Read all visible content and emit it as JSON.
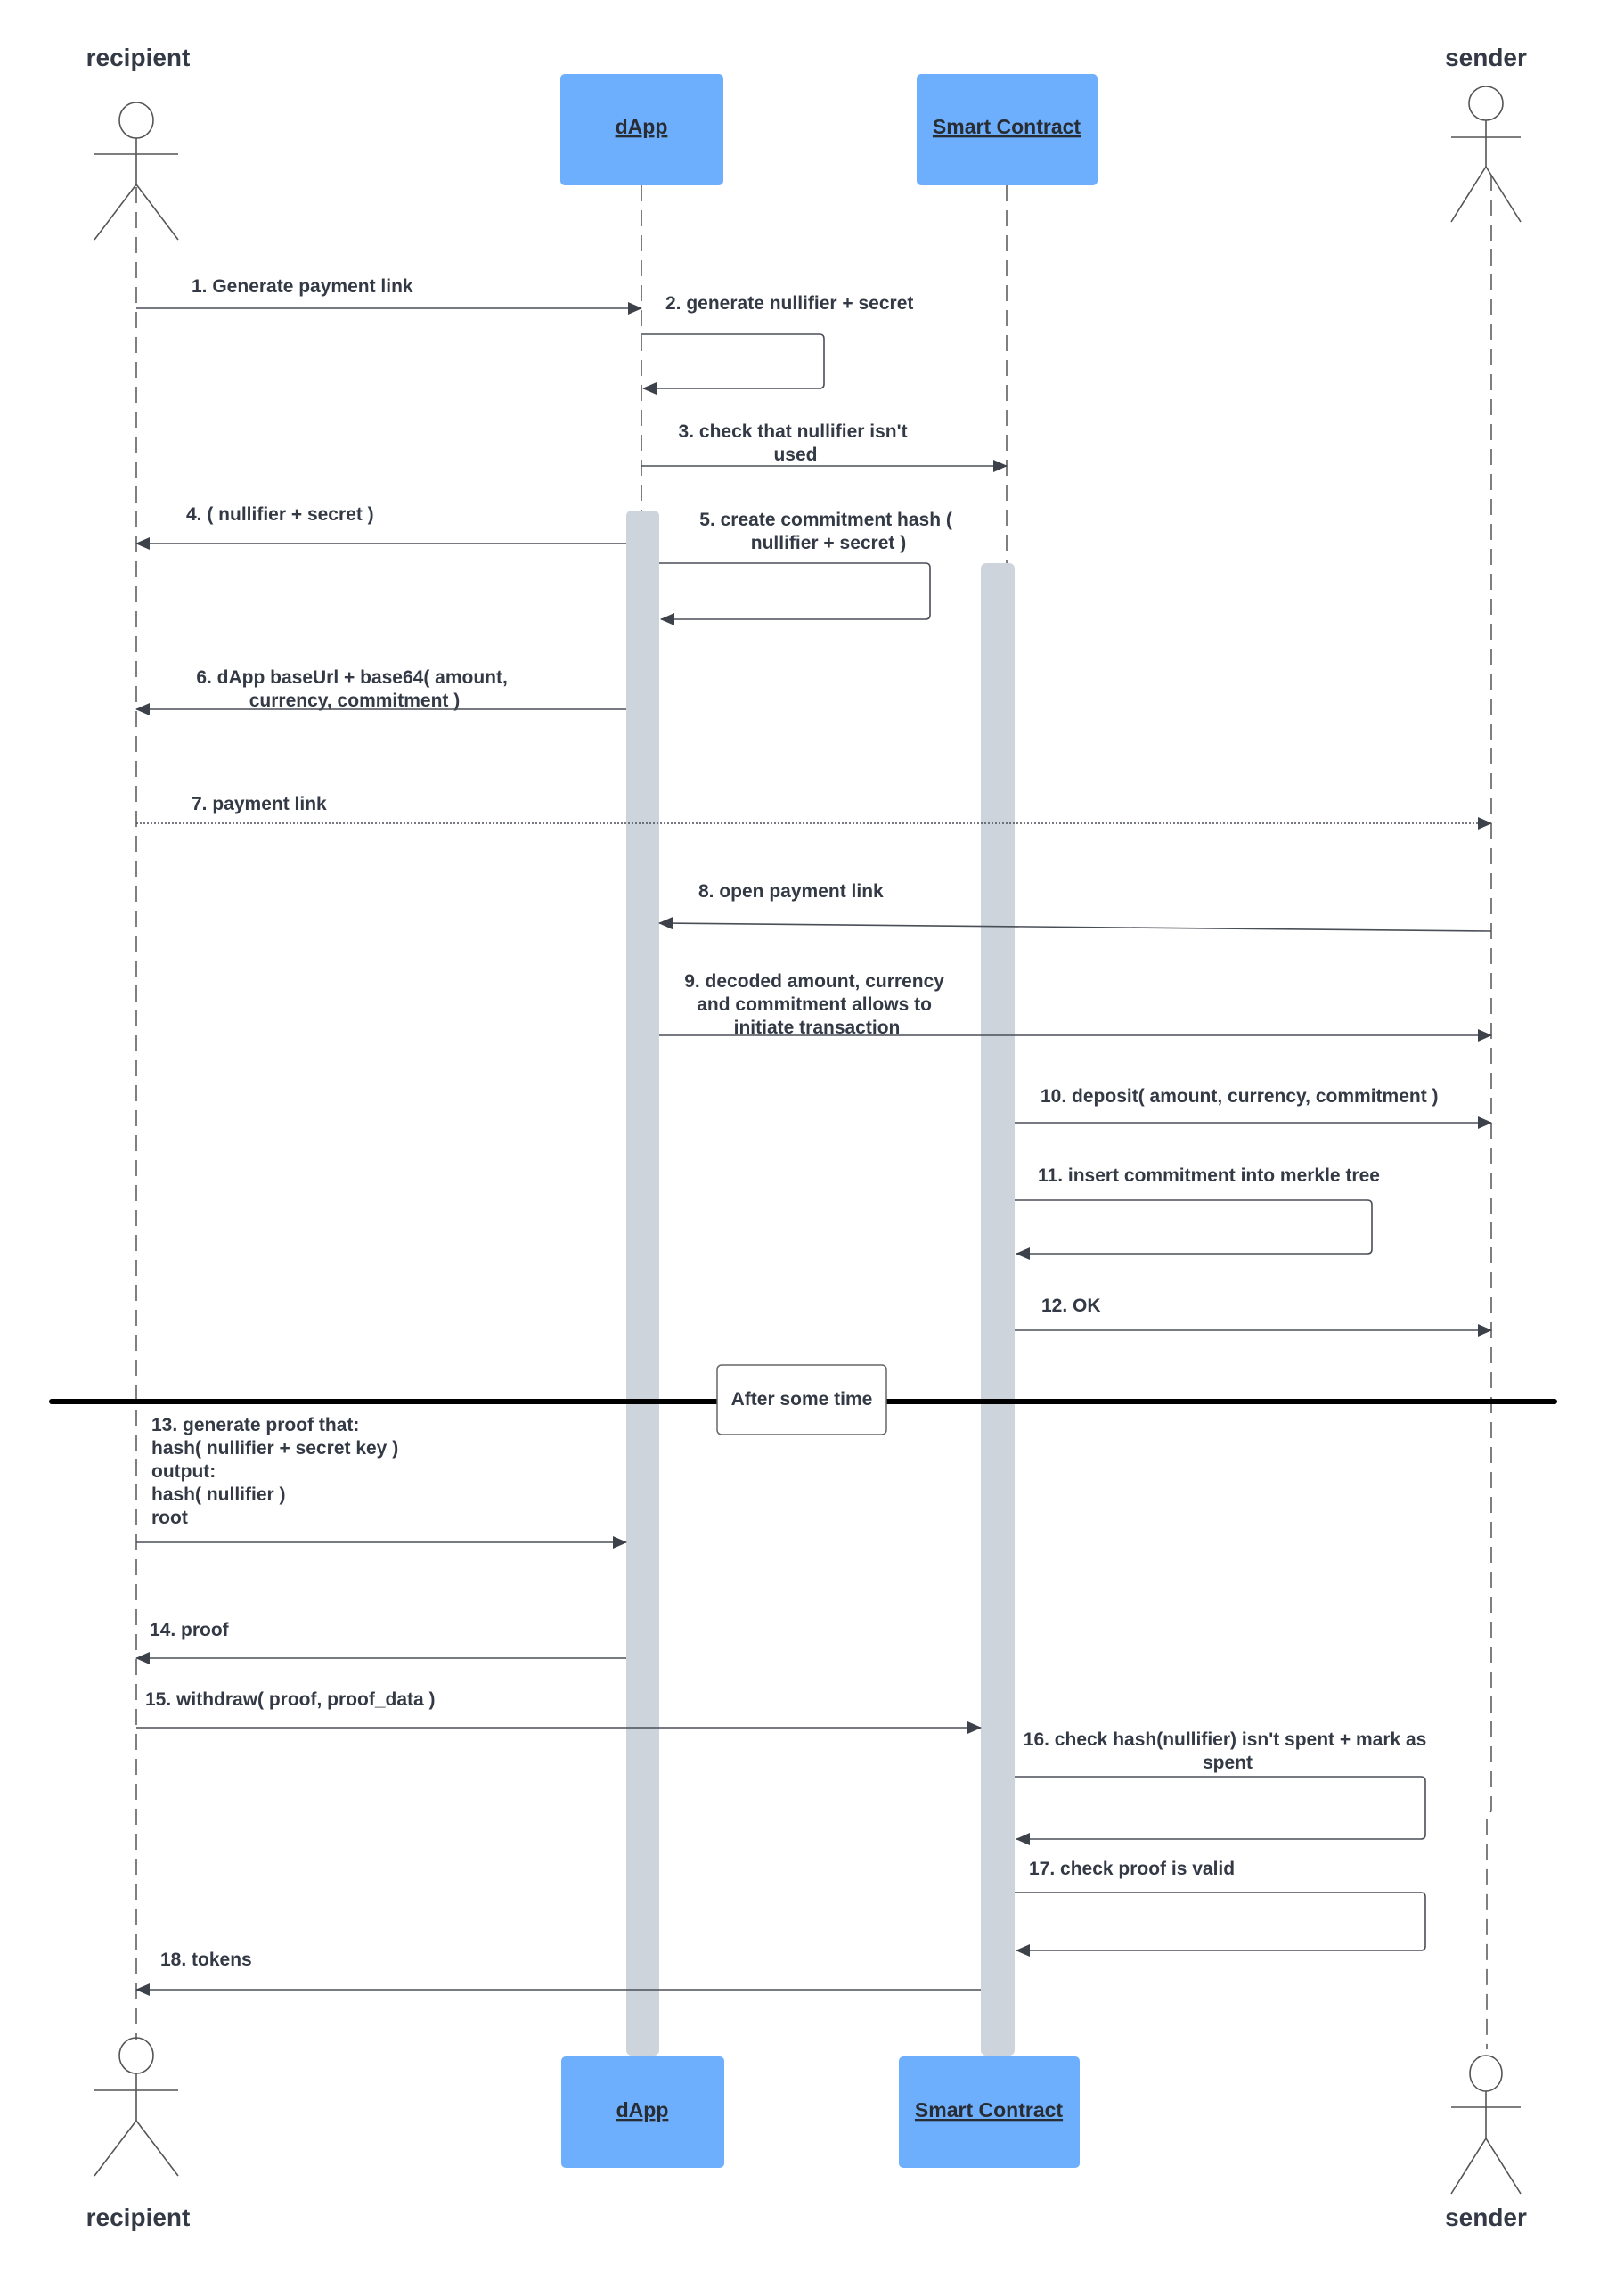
{
  "participants": {
    "recipient": {
      "label": "recipient"
    },
    "dapp": {
      "label": "dApp"
    },
    "smart_contract": {
      "label": "Smart Contract"
    },
    "sender": {
      "label": "sender"
    }
  },
  "colors": {
    "participant_box": "#6eaffd",
    "activation": "#ced4dc",
    "text": "#333a45"
  },
  "messages": [
    {
      "n": 1,
      "from": "recipient",
      "to": "dapp",
      "style": "solid",
      "lines": [
        "1. Generate payment link"
      ]
    },
    {
      "n": 2,
      "from": "dapp",
      "to": "dapp",
      "style": "self",
      "lines": [
        "2. generate nullifier + secret"
      ]
    },
    {
      "n": 3,
      "from": "dapp",
      "to": "smart_contract",
      "style": "solid",
      "lines": [
        "3. check that nullifier isn't",
        "used"
      ]
    },
    {
      "n": 4,
      "from": "dapp",
      "to": "recipient",
      "style": "solid",
      "lines": [
        "4. ( nullifier + secret )"
      ]
    },
    {
      "n": 5,
      "from": "dapp",
      "to": "dapp",
      "style": "self",
      "lines": [
        "5. create commitment hash (",
        "nullifier + secret )"
      ]
    },
    {
      "n": 6,
      "from": "dapp",
      "to": "recipient",
      "style": "solid",
      "lines": [
        "6. dApp baseUrl + base64( amount,",
        "currency, commitment )"
      ]
    },
    {
      "n": 7,
      "from": "recipient",
      "to": "sender",
      "style": "dotted",
      "lines": [
        "7. payment link"
      ]
    },
    {
      "n": 8,
      "from": "sender",
      "to": "dapp",
      "style": "solid",
      "lines": [
        "8. open payment link"
      ]
    },
    {
      "n": 9,
      "from": "dapp",
      "to": "sender",
      "style": "solid",
      "lines": [
        "9. decoded amount, currency",
        "and commitment allows to",
        "initiate transaction"
      ]
    },
    {
      "n": 10,
      "from": "smart_contract",
      "to": "sender",
      "style": "solid",
      "lines": [
        "10. deposit( amount, currency, commitment )"
      ]
    },
    {
      "n": 11,
      "from": "smart_contract",
      "to": "smart_contract",
      "style": "self",
      "lines": [
        "11. insert commitment into merkle tree"
      ]
    },
    {
      "n": 12,
      "from": "smart_contract",
      "to": "sender",
      "style": "solid",
      "lines": [
        "12. OK"
      ]
    },
    {
      "n": 13,
      "from": "recipient",
      "to": "dapp",
      "style": "solid",
      "lines": [
        "13. generate proof that:",
        "hash( nullifier + secret key )",
        "output:",
        "hash( nullifier )",
        "root"
      ]
    },
    {
      "n": 14,
      "from": "dapp",
      "to": "recipient",
      "style": "solid",
      "lines": [
        "14. proof"
      ]
    },
    {
      "n": 15,
      "from": "recipient",
      "to": "smart_contract",
      "style": "solid",
      "lines": [
        "15. withdraw( proof, proof_data )"
      ]
    },
    {
      "n": 16,
      "from": "smart_contract",
      "to": "smart_contract",
      "style": "self",
      "lines": [
        "16. check hash(nullifier) isn't spent + mark as",
        "spent"
      ]
    },
    {
      "n": 17,
      "from": "smart_contract",
      "to": "smart_contract",
      "style": "self",
      "lines": [
        "17. check proof is valid"
      ]
    },
    {
      "n": 18,
      "from": "smart_contract",
      "to": "recipient",
      "style": "solid",
      "lines": [
        "18. tokens"
      ]
    }
  ],
  "divider": {
    "label": "After some time"
  }
}
